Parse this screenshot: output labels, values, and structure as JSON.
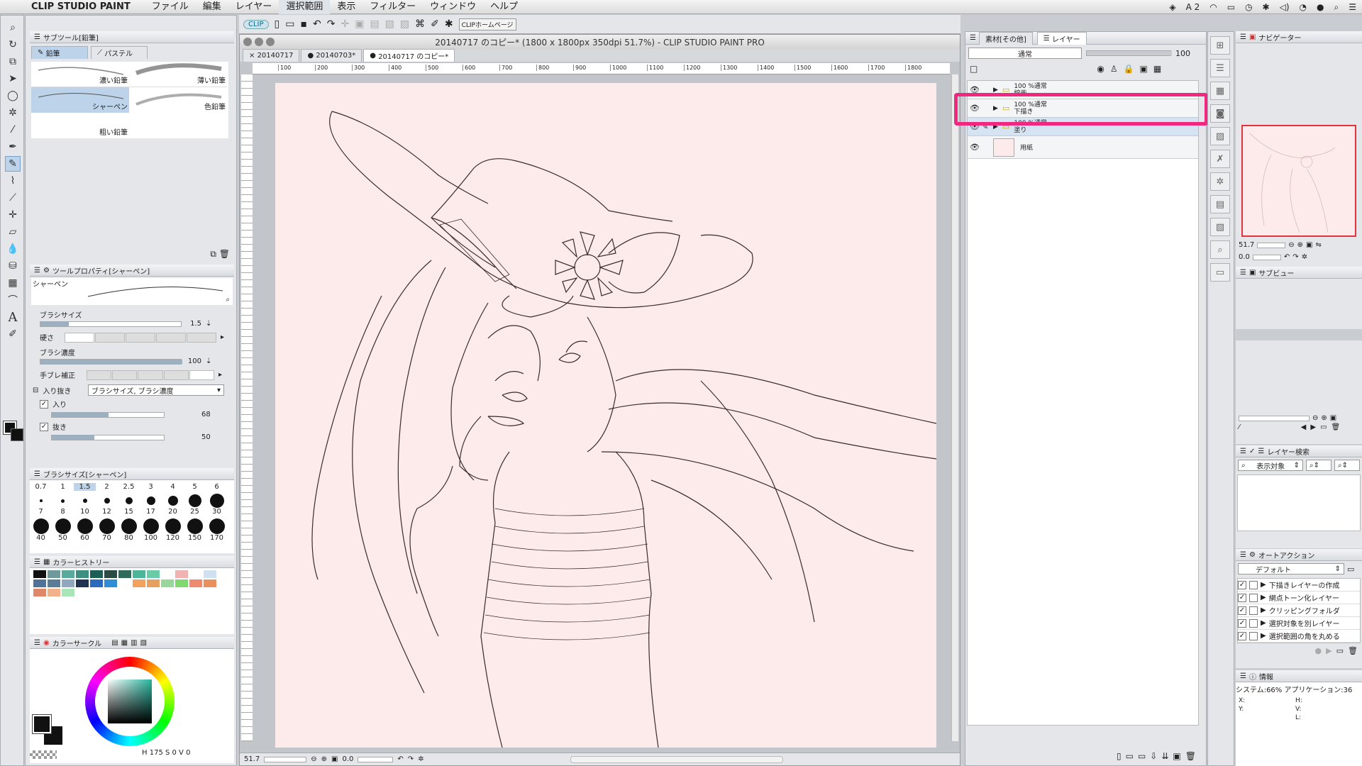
{
  "menubar": {
    "app_name": "CLIP STUDIO PAINT",
    "items": [
      "ファイル",
      "編集",
      "レイヤー",
      "選択範囲",
      "表示",
      "フィルター",
      "ウィンドウ",
      "ヘルプ"
    ],
    "status_a2": "A 2"
  },
  "toolbar": {
    "clip_label": "CLIP",
    "home_button": "CLIPホームページ"
  },
  "document": {
    "title": "20140717 のコピー* (1800 x 1800px 350dpi 51.7%)  - CLIP STUDIO PAINT PRO",
    "tabs": [
      "20140717",
      "20140703*",
      "20140717 のコピー*"
    ],
    "ruler_marks": [
      "100",
      "200",
      "300",
      "400",
      "500",
      "600",
      "700",
      "800",
      "900",
      "1000",
      "1100",
      "1200",
      "1300",
      "1400",
      "1500",
      "1600",
      "1700",
      "1800"
    ],
    "zoom": "51.7",
    "rotation": "0.0"
  },
  "subtool": {
    "title": "サブツール[鉛筆]",
    "tabs": [
      "鉛筆",
      "パステル"
    ],
    "brushes": [
      {
        "name": "濃い鉛筆"
      },
      {
        "name": "薄い鉛筆"
      },
      {
        "name": "シャーペン"
      },
      {
        "name": "色鉛筆"
      },
      {
        "name": "粗い鉛筆"
      }
    ]
  },
  "tool_property": {
    "title": "ツールプロパティ[シャーペン]",
    "preview_label": "シャーペン",
    "brush_size_label": "ブラシサイズ",
    "brush_size": "1.5",
    "hardness_label": "硬さ",
    "density_label": "ブラシ濃度",
    "density": "100",
    "stabilization_label": "手ブレ補正",
    "taper_label": "入り抜き",
    "taper_value": "ブラシサイズ, ブラシ濃度",
    "taper_in_label": "入り",
    "taper_in": "68",
    "taper_out_label": "抜き",
    "taper_out": "50"
  },
  "brush_size_panel": {
    "title": "ブラシサイズ[シャーペン]",
    "row1": [
      "0.7",
      "1",
      "1.5",
      "2",
      "2.5",
      "3",
      "4",
      "5",
      "6"
    ],
    "row2": [
      "7",
      "8",
      "10",
      "12",
      "15",
      "17",
      "20",
      "25",
      "30"
    ],
    "row3": [
      "40",
      "50",
      "60",
      "70",
      "80",
      "100",
      "120",
      "150",
      "170"
    ]
  },
  "color_history": {
    "title": "カラーヒストリー",
    "row1": [
      "#111111",
      "#6f9a9c",
      "#5aa99d",
      "#3e8f80",
      "#1e5f55",
      "#2d4b45",
      "#2f6a5a",
      "#4db59a",
      "#6bcaa8",
      "#ffffff",
      "#f1b2b2",
      "#ffffff",
      "#cfe0f0"
    ],
    "row2": [
      "#50729a",
      "#5b7b97",
      "#8fa8c0",
      "#1f3350",
      "#2a6bc0",
      "#2e8fd6",
      "#ffffff",
      "#f3a15e",
      "#e6a060",
      "#98d69c",
      "#7fd870",
      "#f08a6f",
      "#e9905d"
    ],
    "row3": [
      "#e0876a",
      "#f1b18a",
      "#a8e6b8"
    ]
  },
  "color_circle": {
    "title": "カラーサークル",
    "h_label": "H",
    "values": "175 S  0 V  0"
  },
  "layers": {
    "tab_material": "素材[その他]",
    "tab_layer": "レイヤー",
    "blend_mode": "通常",
    "opacity": "100",
    "rows": [
      {
        "mode": "100 %通常",
        "name": "線画"
      },
      {
        "mode": "100 %通常",
        "name": "下描き"
      },
      {
        "mode": "100 %通常",
        "name": "塗り"
      },
      {
        "mode": "",
        "name": "用紙"
      }
    ]
  },
  "navigator": {
    "title": "ナビゲーター",
    "zoom": "51.7",
    "rotate": "0.0"
  },
  "subview": {
    "title": "サブビュー"
  },
  "layer_search": {
    "title": "レイヤー検索",
    "filter": "表示対象"
  },
  "auto_action": {
    "title": "オートアクション",
    "set": "デフォルト",
    "items": [
      "下描きレイヤーの作成",
      "網点トーン化レイヤー",
      "クリッピングフォルダ",
      "選択対象を別レイヤー",
      "選択範囲の角を丸める"
    ]
  },
  "info": {
    "title": "情報",
    "system": "システム:66% アプリケーション:36",
    "x_label": "X:",
    "y_label": "Y:",
    "h_label": "H:",
    "v_label": "V:",
    "l_label": "L:"
  },
  "colors": {
    "highlight": "#f0287f",
    "canvas_bg": "#fcebea",
    "selection": "#d5e3f3"
  }
}
